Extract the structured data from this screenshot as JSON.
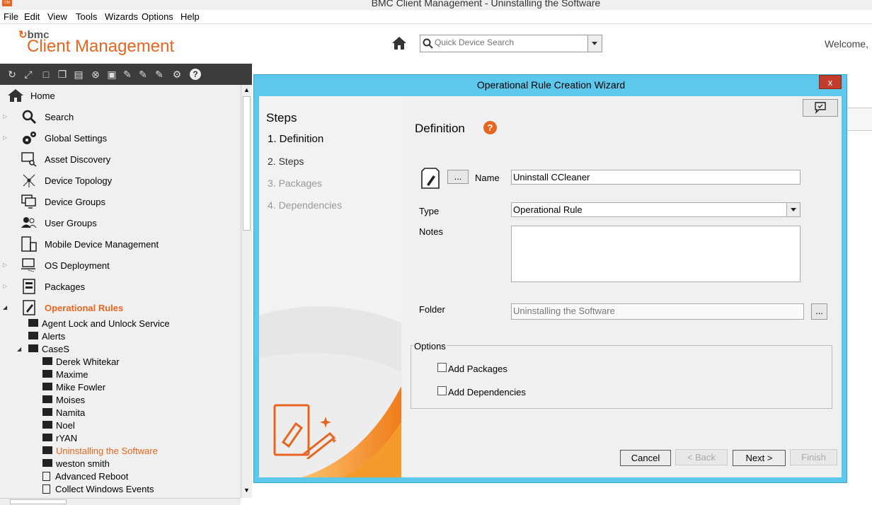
{
  "window": {
    "title": "BMC Client Management - Uninstalling the Software",
    "icon_text": "CM"
  },
  "menu": [
    "File",
    "Edit",
    "View",
    "Tools",
    "Wizards",
    "Options",
    "Help"
  ],
  "header": {
    "logo_brand": "bmc",
    "logo_product": "Client Management",
    "search_placeholder": "Quick Device Search",
    "welcome": "Welcome,"
  },
  "nav": {
    "items": [
      {
        "label": "Home",
        "icon": "home-icon"
      },
      {
        "label": "Search",
        "icon": "search-icon"
      },
      {
        "label": "Global Settings",
        "icon": "gears-icon"
      },
      {
        "label": "Asset Discovery",
        "icon": "asset-discovery-icon"
      },
      {
        "label": "Device Topology",
        "icon": "topology-icon"
      },
      {
        "label": "Device Groups",
        "icon": "device-groups-icon"
      },
      {
        "label": "User Groups",
        "icon": "user-groups-icon"
      },
      {
        "label": "Mobile Device Management",
        "icon": "mobile-icon"
      },
      {
        "label": "OS Deployment",
        "icon": "os-deployment-icon"
      },
      {
        "label": "Packages",
        "icon": "packages-icon"
      },
      {
        "label": "Operational Rules",
        "icon": "operational-rules-icon"
      }
    ],
    "tree": [
      "Agent Lock and Unlock Service",
      "Alerts",
      "CaseS",
      "Derek Whitekar",
      "Maxime",
      "Mike Fowler",
      "Moises",
      "Namita",
      "Noel",
      "rYAN",
      "Uninstalling the Software",
      "weston smith",
      "Advanced Reboot",
      "Collect Windows Events"
    ]
  },
  "dialog": {
    "title": "Operational Rule Creation Wizard",
    "close": "x",
    "steps_heading": "Steps",
    "steps": [
      "1. Definition",
      "2. Steps",
      "3. Packages",
      "4. Dependencies"
    ],
    "section_title": "Definition",
    "help": "?",
    "browse": "...",
    "name_label": "Name",
    "name_value": "Uninstall CCleaner",
    "type_label": "Type",
    "type_value": "Operational Rule",
    "notes_label": "Notes",
    "folder_label": "Folder",
    "folder_value": "Uninstalling the Software",
    "options_label": "Options",
    "add_packages": "Add Packages",
    "add_dependencies": "Add Dependencies",
    "buttons": {
      "cancel": "Cancel",
      "back": "< Back",
      "next": "Next >",
      "finish": "Finish"
    }
  },
  "colors": {
    "accent": "#e8651f",
    "dialog_border": "#5bc8ec",
    "toolbar": "#3c3c3c",
    "close": "#c63c2c"
  }
}
